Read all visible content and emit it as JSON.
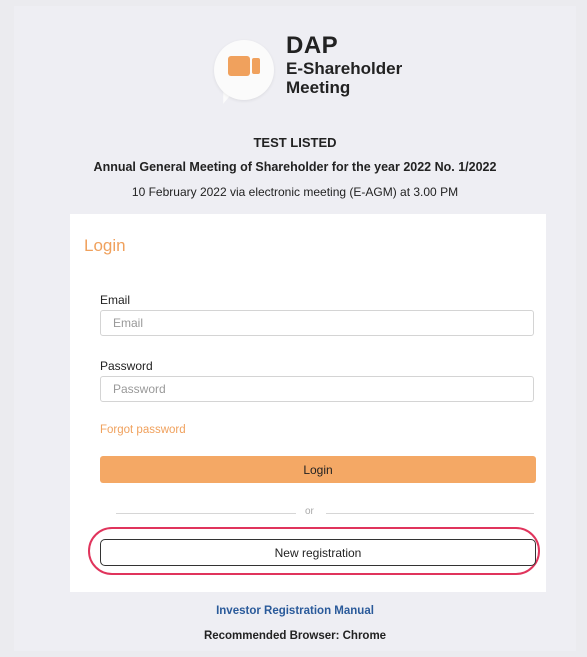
{
  "brand": {
    "name": "DAP",
    "line1": "E-Shareholder",
    "line2": "Meeting"
  },
  "event": {
    "company": "TEST LISTED",
    "meeting": "Annual General Meeting of Shareholder for the year 2022 No. 1/2022",
    "datetime": "10 February 2022 via electronic meeting (E-AGM) at 3.00 PM"
  },
  "login": {
    "title": "Login",
    "email_label": "Email",
    "email_placeholder": "Email",
    "email_value": "",
    "password_label": "Password",
    "password_placeholder": "Password",
    "password_value": "",
    "forgot_label": "Forgot password",
    "login_button": "Login",
    "or_text": "or",
    "register_button": "New registration"
  },
  "footer": {
    "manual_link": "Investor Registration Manual",
    "browser_note": "Recommended Browser: Chrome"
  },
  "colors": {
    "accent": "#f0a15d",
    "highlight": "#e0345c",
    "link": "#2a5a9a"
  },
  "icons": {
    "logo": "video-camera-chat-bubble-icon"
  }
}
